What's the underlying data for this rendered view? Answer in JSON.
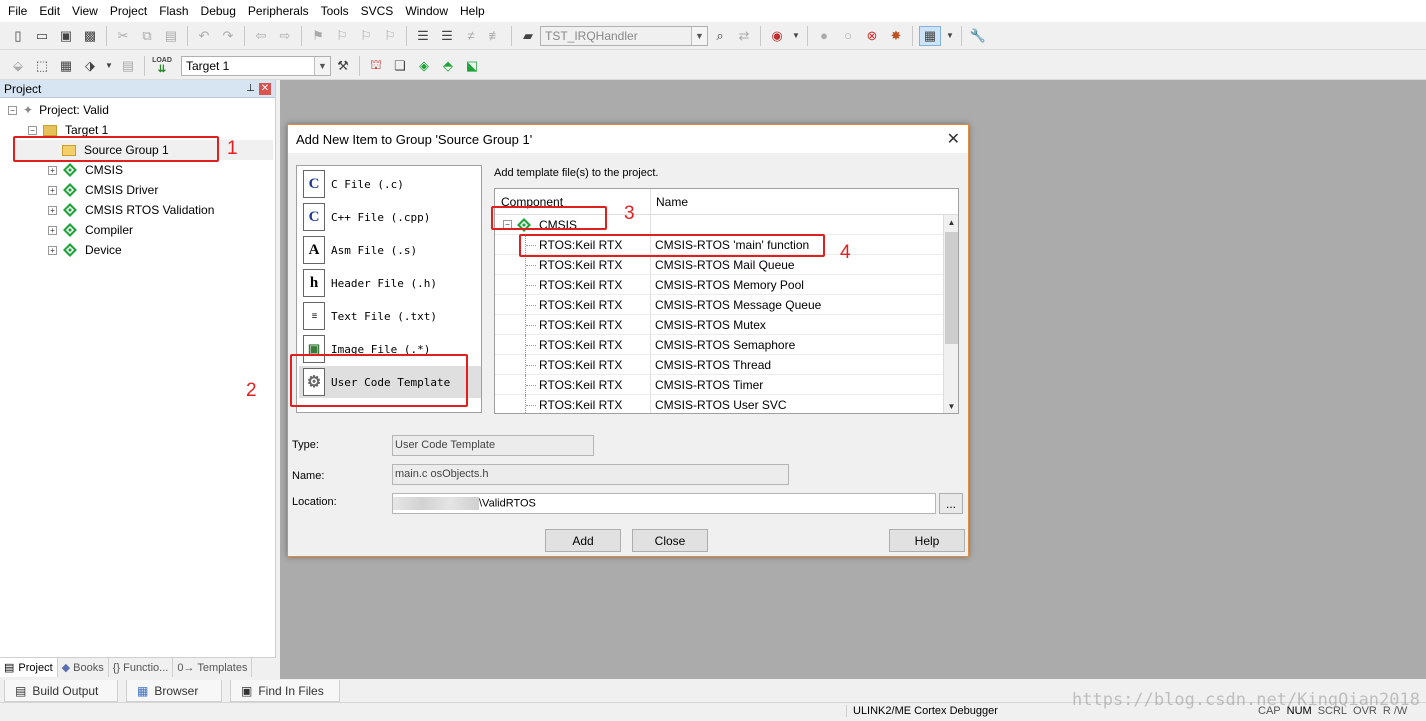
{
  "menu": [
    "File",
    "Edit",
    "View",
    "Project",
    "Flash",
    "Debug",
    "Peripherals",
    "Tools",
    "SVCS",
    "Window",
    "Help"
  ],
  "toolbar1": {
    "find_combo": "TST_IRQHandler"
  },
  "toolbar2": {
    "load_label": "LOAD",
    "target_combo": "Target 1"
  },
  "project_panel": {
    "title": "Project",
    "pin": "⬛",
    "root": "Project: Valid",
    "target": "Target 1",
    "source_group": "Source Group 1",
    "components": [
      "CMSIS",
      "CMSIS Driver",
      "CMSIS RTOS Validation",
      "Compiler",
      "Device"
    ],
    "tabs": [
      "Project",
      "Books",
      "{} Functio...",
      "0→ Templates"
    ]
  },
  "bottom_tabs": [
    "Build Output",
    "Browser",
    "Find In Files"
  ],
  "status": {
    "debugger": "ULINK2/ME Cortex Debugger",
    "keys": [
      "CAP",
      "NUM",
      "SCRL",
      "OVR",
      "R /W"
    ]
  },
  "dialog": {
    "title": "Add New Item to Group 'Source Group 1'",
    "file_types": [
      {
        "icon": "C",
        "label": "C File (.c)"
      },
      {
        "icon": "C",
        "label": "C++ File (.cpp)"
      },
      {
        "icon": "A",
        "label": "Asm File (.s)"
      },
      {
        "icon": "h",
        "label": "Header File (.h)"
      },
      {
        "icon": "≡",
        "label": "Text File (.txt)"
      },
      {
        "icon": "▣",
        "label": "Image File (.*)"
      },
      {
        "icon": "⚙",
        "label": "User Code Template"
      }
    ],
    "template_caption": "Add template file(s) to the project.",
    "grid": {
      "col_component": "Component",
      "col_name": "Name",
      "group": "CMSIS",
      "rows": [
        {
          "component": "RTOS:Keil RTX",
          "name": "CMSIS-RTOS 'main' function"
        },
        {
          "component": "RTOS:Keil RTX",
          "name": "CMSIS-RTOS Mail Queue"
        },
        {
          "component": "RTOS:Keil RTX",
          "name": "CMSIS-RTOS Memory Pool"
        },
        {
          "component": "RTOS:Keil RTX",
          "name": "CMSIS-RTOS Message Queue"
        },
        {
          "component": "RTOS:Keil RTX",
          "name": "CMSIS-RTOS Mutex"
        },
        {
          "component": "RTOS:Keil RTX",
          "name": "CMSIS-RTOS Semaphore"
        },
        {
          "component": "RTOS:Keil RTX",
          "name": "CMSIS-RTOS Thread"
        },
        {
          "component": "RTOS:Keil RTX",
          "name": "CMSIS-RTOS Timer"
        },
        {
          "component": "RTOS:Keil RTX",
          "name": "CMSIS-RTOS User SVC"
        }
      ]
    },
    "type_label": "Type:",
    "type_value": "User Code Template",
    "name_label": "Name:",
    "name_value": "main.c osObjects.h",
    "location_label": "Location:",
    "location_value": "\\ValidRTOS",
    "browse_label": "...",
    "buttons": {
      "add": "Add",
      "close": "Close",
      "help": "Help"
    }
  },
  "annotations": [
    "1",
    "2",
    "3",
    "4"
  ],
  "watermark": "https://blog.csdn.net/KingQian2018",
  "colors": {
    "annotation": "#e02020",
    "dialog_border": "#e08a3c",
    "workspace": "#ababab",
    "component_green": "#1ea53a"
  }
}
